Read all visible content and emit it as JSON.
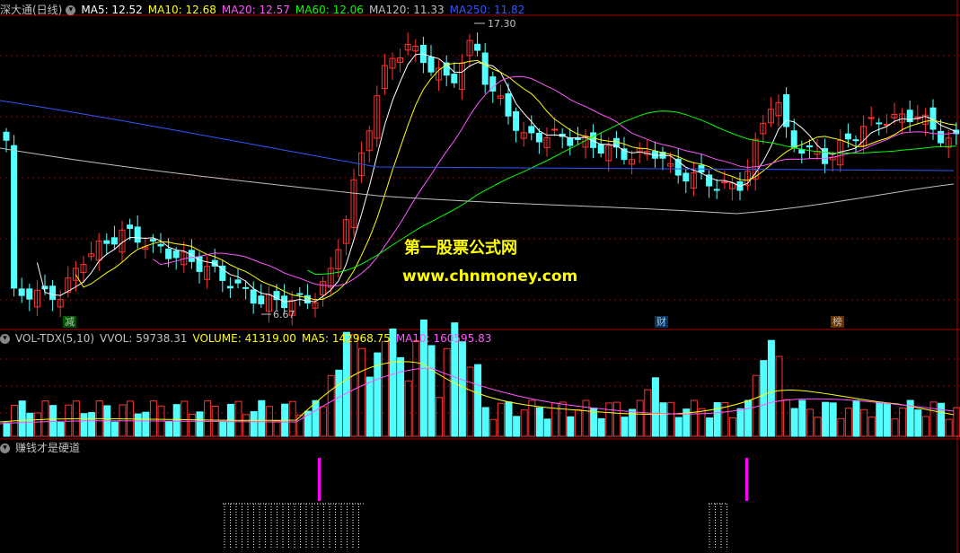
{
  "main_panel": {
    "title": "深大通(日线)",
    "indicators": [
      {
        "label": "MA5: 12.52",
        "color": "#ffffff"
      },
      {
        "label": "MA10: 12.68",
        "color": "#ffff00"
      },
      {
        "label": "MA20: 12.57",
        "color": "#ff55ff"
      },
      {
        "label": "MA60: 12.06",
        "color": "#00ff00"
      },
      {
        "label": "MA120: 11.33",
        "color": "#c0c0c0"
      },
      {
        "label": "MA250: 11.82",
        "color": "#3355ff"
      }
    ],
    "high_label": "17.30",
    "low_label": "6.67",
    "watermark_name": "第一股票公式网",
    "watermark_url": "www.chnmoney.com",
    "event_marks": [
      {
        "label": "减",
        "color": "#00cc00"
      },
      {
        "label": "财",
        "color": "#00aaff"
      },
      {
        "label": "榜",
        "color": "#ff9900"
      }
    ]
  },
  "volume_panel": {
    "indicators": [
      {
        "label": "VOL-TDX(5,10)",
        "color": "#c0c0c0"
      },
      {
        "label": "VVOL: 59738.31",
        "color": "#c0c0c0"
      },
      {
        "label": "VOLUME: 41319.00",
        "color": "#ffff00"
      },
      {
        "label": "MA5: 142968.75",
        "color": "#ffff00"
      },
      {
        "label": "MA10: 160595.83",
        "color": "#ff55ff"
      }
    ]
  },
  "signal_panel": {
    "title": "赚钱才是硬道"
  },
  "colors": {
    "up": "#ff3232",
    "down": "#54ffff",
    "grid": "#8b0000",
    "divider": "#b00000"
  }
}
